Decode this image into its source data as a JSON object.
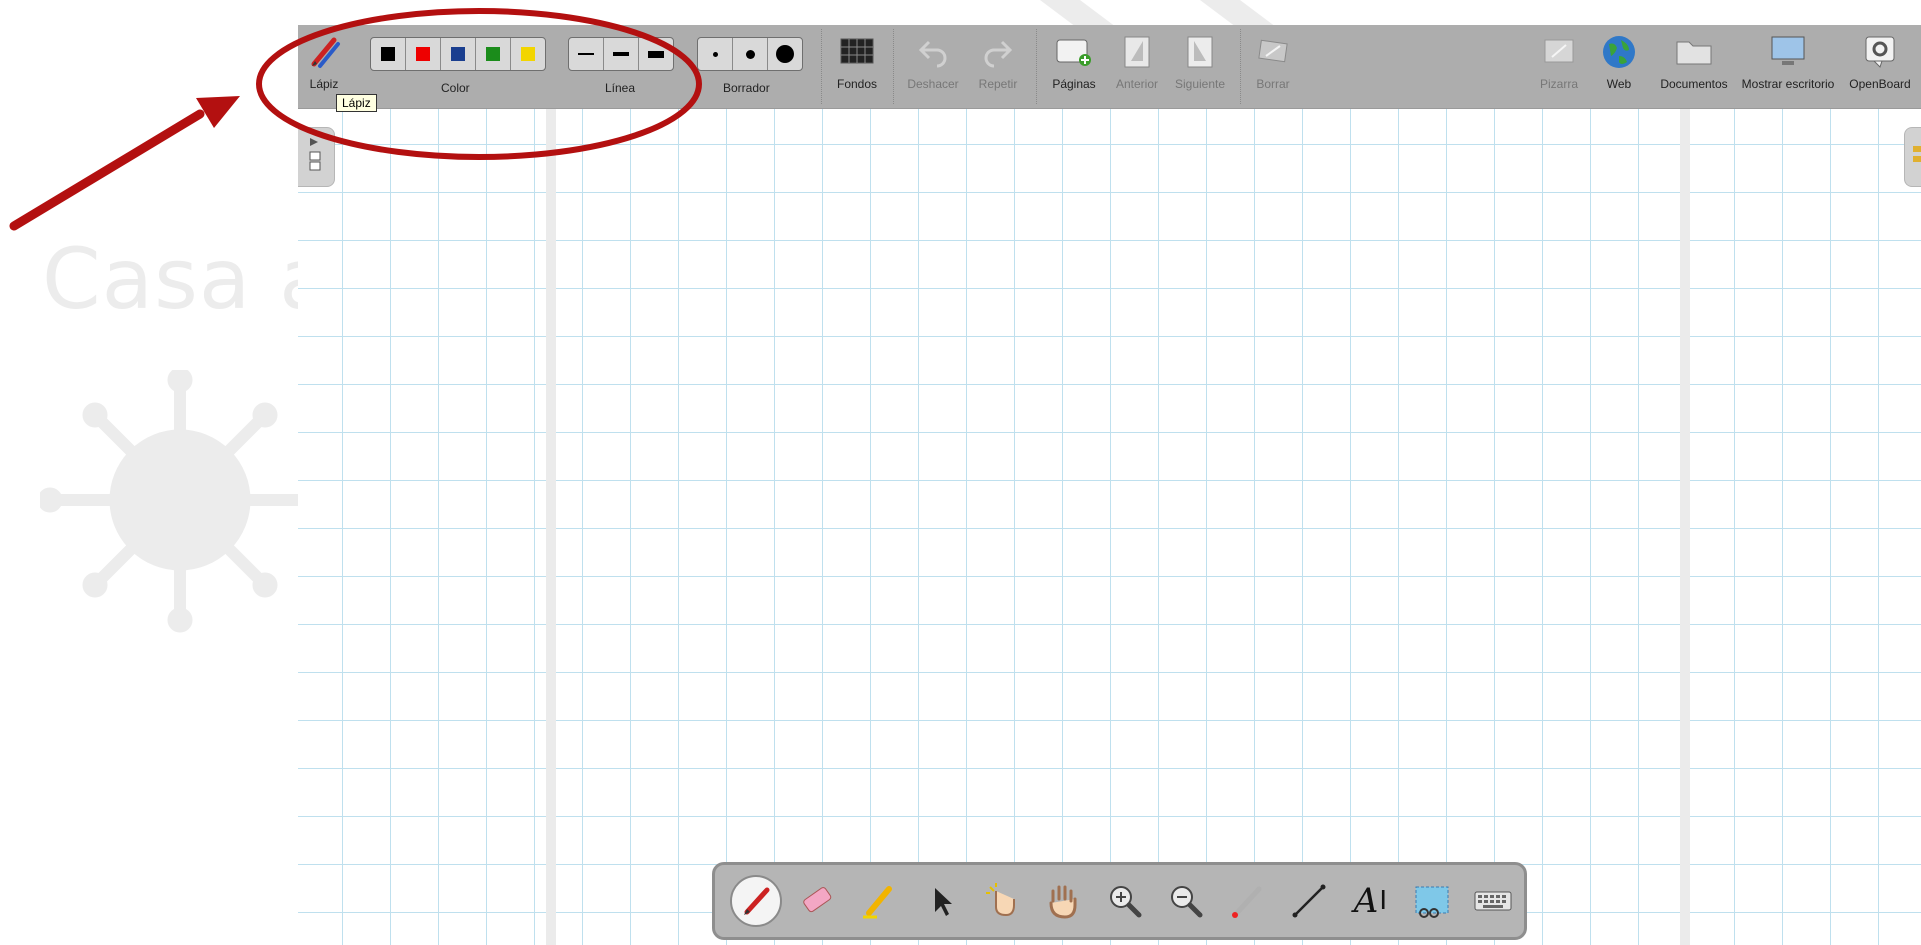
{
  "background": {
    "slide_text": "Casa al"
  },
  "toolbar": {
    "pen": {
      "label": "Lápiz",
      "icon": "pen-icon"
    },
    "color": {
      "label": "Color",
      "swatches": [
        "#000000",
        "#ee0000",
        "#1a3e8f",
        "#1b8c1b",
        "#f2d500"
      ]
    },
    "line": {
      "label": "Línea"
    },
    "eraser": {
      "label": "Borrador"
    },
    "backgrounds": {
      "label": "Fondos",
      "icon": "backgrounds-icon"
    },
    "undo": {
      "label": "Deshacer",
      "icon": "undo-icon"
    },
    "redo": {
      "label": "Repetir",
      "icon": "redo-icon"
    },
    "pages": {
      "label": "Páginas",
      "icon": "add-page-icon"
    },
    "previous": {
      "label": "Anterior",
      "icon": "previous-page-icon"
    },
    "next": {
      "label": "Siguiente",
      "icon": "next-page-icon"
    },
    "erase": {
      "label": "Borrar",
      "icon": "clear-icon"
    },
    "board": {
      "label": "Pizarra",
      "icon": "board-icon"
    },
    "web": {
      "label": "Web",
      "icon": "globe-icon"
    },
    "documents": {
      "label": "Documentos",
      "icon": "folder-icon"
    },
    "desktop": {
      "label": "Mostrar escritorio",
      "icon": "monitor-icon"
    },
    "openboard": {
      "label": "OpenBoard",
      "icon": "settings-icon"
    }
  },
  "tooltip": {
    "text": "Lápiz"
  },
  "palette": {
    "tools": [
      "pen-icon",
      "eraser-icon",
      "highlighter-icon",
      "pointer-icon",
      "laser-hand-icon",
      "hand-icon",
      "zoom-in-icon",
      "zoom-out-icon",
      "laser-pointer-icon",
      "line-icon",
      "text-icon",
      "capture-icon",
      "keyboard-icon"
    ],
    "text_tool_glyph": "A"
  },
  "colors": {
    "toolbar": "#adadad",
    "grid": "#bfe0ee",
    "annotation": "#b31010"
  }
}
